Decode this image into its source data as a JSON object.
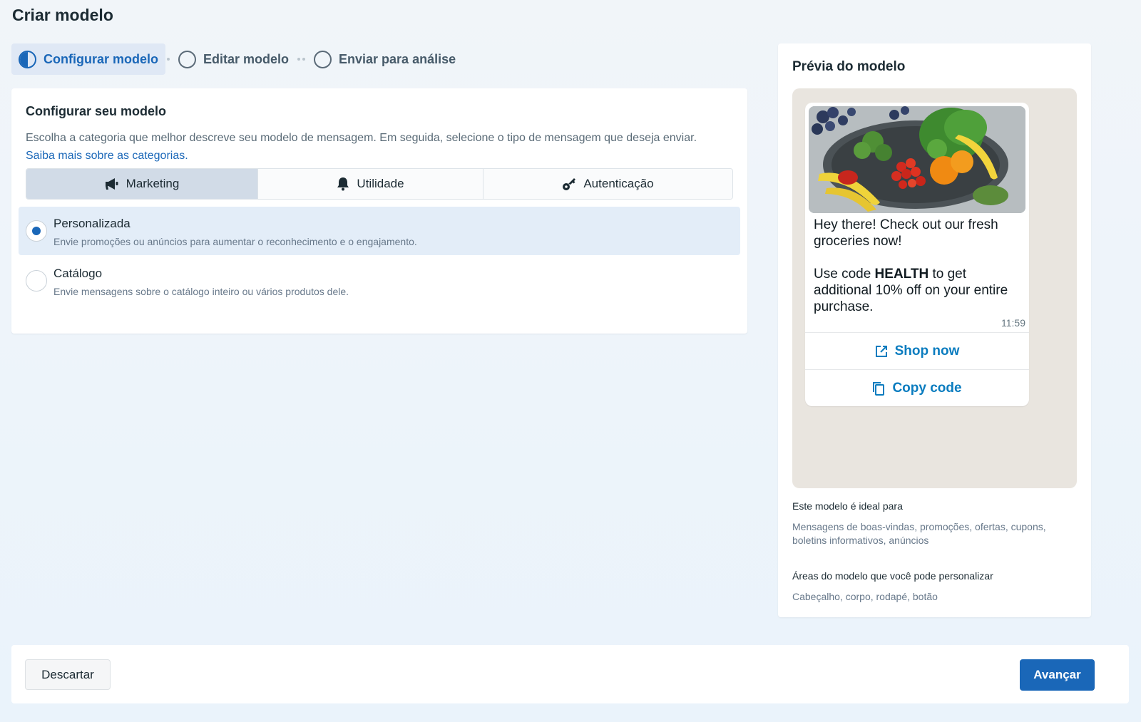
{
  "page": {
    "title": "Criar modelo"
  },
  "stepper": {
    "steps": [
      {
        "label": "Configurar modelo",
        "state": "active"
      },
      {
        "label": "Editar modelo",
        "state": "pending"
      },
      {
        "label": "Enviar para análise",
        "state": "pending"
      }
    ]
  },
  "config": {
    "title": "Configurar seu modelo",
    "description": "Escolha a categoria que melhor descreve seu modelo de mensagem. Em seguida, selecione o tipo de mensagem que deseja enviar.",
    "learn_more": "Saiba mais sobre as categorias.",
    "categories": [
      {
        "label": "Marketing",
        "icon": "megaphone-icon",
        "selected": true
      },
      {
        "label": "Utilidade",
        "icon": "bell-icon",
        "selected": false
      },
      {
        "label": "Autenticação",
        "icon": "key-icon",
        "selected": false
      }
    ],
    "options": [
      {
        "title": "Personalizada",
        "desc": "Envie promoções ou anúncios para aumentar o reconhecimento e o engajamento.",
        "checked": true
      },
      {
        "title": "Catálogo",
        "desc": "Envie mensagens sobre o catálogo inteiro ou vários produtos dele.",
        "checked": false
      }
    ]
  },
  "preview": {
    "title": "Prévia do modelo",
    "message": {
      "line1": "Hey there! Check out our fresh groceries now!",
      "line2_prefix": "Use code ",
      "line2_code": "HEALTH",
      "line2_suffix": " to get additional 10% off on your entire purchase.",
      "time": "11:59",
      "buttons": [
        {
          "label": "Shop now",
          "icon": "external-link-icon"
        },
        {
          "label": "Copy code",
          "icon": "copy-icon"
        }
      ]
    },
    "ideal_for_label": "Este modelo é ideal para",
    "ideal_for_text": "Mensagens de boas-vindas, promoções, ofertas, cupons, boletins informativos, anúncios",
    "custom_areas_label": "Áreas do modelo que você pode personalizar",
    "custom_areas_text": "Cabeçalho, corpo, rodapé, botão"
  },
  "footer": {
    "discard_label": "Descartar",
    "next_label": "Avançar"
  },
  "colors": {
    "accent": "#1a67b8",
    "whatsapp_link": "#0a7cbf",
    "chat_background": "#e9e5df"
  }
}
